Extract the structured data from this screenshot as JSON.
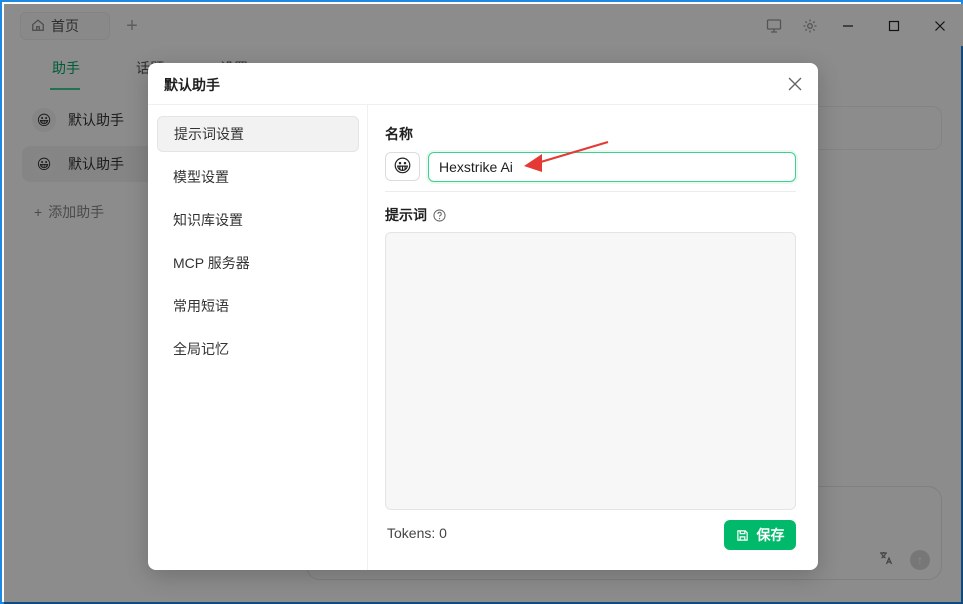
{
  "titlebar": {
    "home_tab_label": "首页",
    "add_tab_symbol": "+"
  },
  "background": {
    "tabs": [
      "助手",
      "话题",
      "设置"
    ],
    "assistants": [
      "默认助手",
      "默认助手"
    ],
    "add_assistant_label": "添加助手"
  },
  "modal": {
    "title": "默认助手",
    "nav_items": [
      "提示词设置",
      "模型设置",
      "知识库设置",
      "MCP 服务器",
      "常用短语",
      "全局记忆"
    ],
    "active_nav_index": 0,
    "name_label": "名称",
    "name_value": "Hexstrike Ai",
    "emoji": "😀",
    "prompt_label": "提示词",
    "prompt_value": "",
    "tokens_text": "Tokens: 0",
    "save_label": "保存"
  },
  "colors": {
    "accent": "#00b96b",
    "input_focus_border": "#3fcf8e",
    "window_border": "#1e88e5",
    "annotation_arrow": "#e53935"
  }
}
